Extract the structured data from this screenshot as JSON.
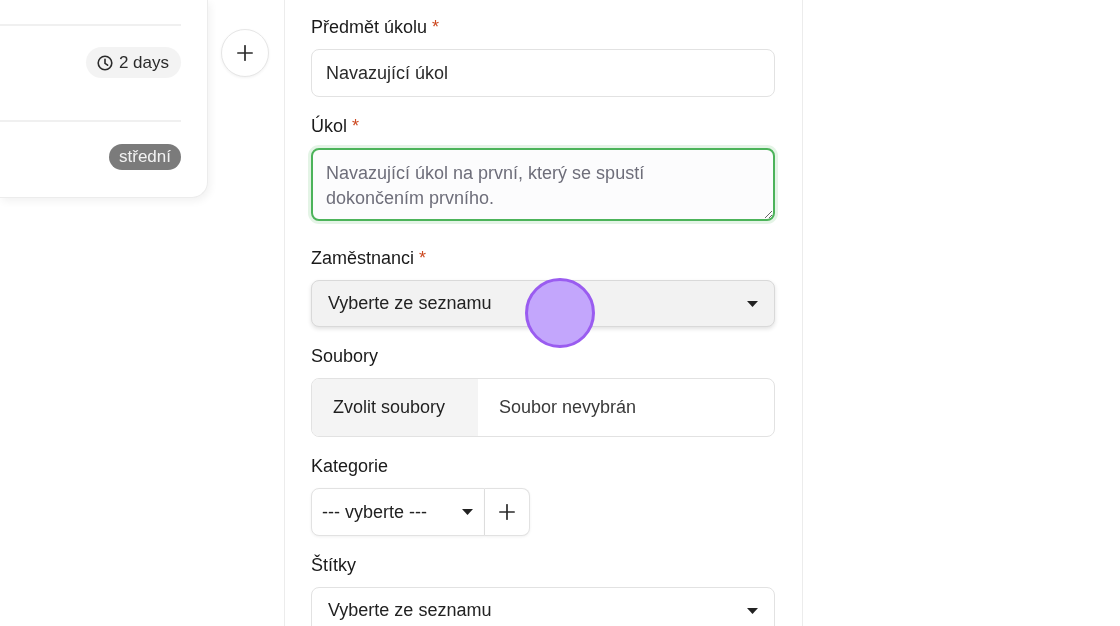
{
  "task_card": {
    "badges": [
      {
        "kind": "duration",
        "text": "2 days"
      },
      {
        "kind": "priority",
        "text": "střední"
      }
    ]
  },
  "form": {
    "fields": [
      {
        "kind": "text",
        "label": "Předmět úkolu",
        "required_mark": "*",
        "value": "Navazující úkol",
        "focused": false,
        "hovered": false
      },
      {
        "kind": "textarea",
        "label": "Úkol",
        "required_mark": "*",
        "placeholder": "Navazující úkol na první, který se spustí dokončením prvního.",
        "focused": true,
        "hovered": false
      },
      {
        "kind": "select",
        "label": "Zaměstnanci",
        "required_mark": "*",
        "value": "Vyberte ze seznamu",
        "focused": false,
        "hovered": true
      },
      {
        "kind": "file",
        "label": "Soubory",
        "button_label": "Zvolit soubory",
        "status": "Soubor nevybrán",
        "focused": false,
        "hovered": false
      },
      {
        "kind": "select_add",
        "label": "Kategorie",
        "value": "--- vyberte ---",
        "focused": false,
        "hovered": false
      },
      {
        "kind": "select",
        "label": "Štítky",
        "value": "Vyberte ze seznamu",
        "focused": false,
        "hovered": false
      }
    ]
  }
}
